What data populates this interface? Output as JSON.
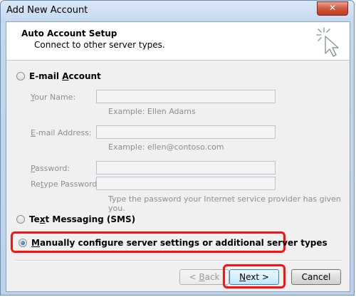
{
  "window": {
    "title": "Add New Account",
    "close_label": "✕"
  },
  "header": {
    "title": "Auto Account Setup",
    "subtitle": "Connect to other server types."
  },
  "email_account": {
    "option_label_pre": "E-mail ",
    "option_label_u": "A",
    "option_label_post": "ccount",
    "selected": false,
    "fields": {
      "your_name": {
        "label_u": "Y",
        "label_rest": "our Name:",
        "value": "",
        "hint": "Example: Ellen Adams"
      },
      "email_address": {
        "label_u": "E",
        "label_rest": "-mail Address:",
        "value": "",
        "hint": "Example: ellen@contoso.com"
      },
      "password": {
        "label_u": "P",
        "label_rest": "assword:",
        "value": ""
      },
      "retype_password": {
        "label_pre": "Re",
        "label_u": "t",
        "label_rest": "ype Password:",
        "value": "",
        "hint": "Type the password your Internet service provider has given you."
      }
    }
  },
  "text_messaging": {
    "label_u": "x",
    "label_pre": "Te",
    "label_post": "t Messaging (SMS)",
    "selected": false
  },
  "manual_config": {
    "label_u": "M",
    "label_rest": "anually configure server settings or additional server types",
    "selected": true
  },
  "buttons": {
    "back": {
      "lt": "< ",
      "u": "B",
      "rest": "ack",
      "enabled": false
    },
    "next": {
      "u": "N",
      "rest": "ext >",
      "enabled": true
    },
    "cancel": {
      "label": "Cancel"
    }
  },
  "highlight_color": "#ff1010"
}
